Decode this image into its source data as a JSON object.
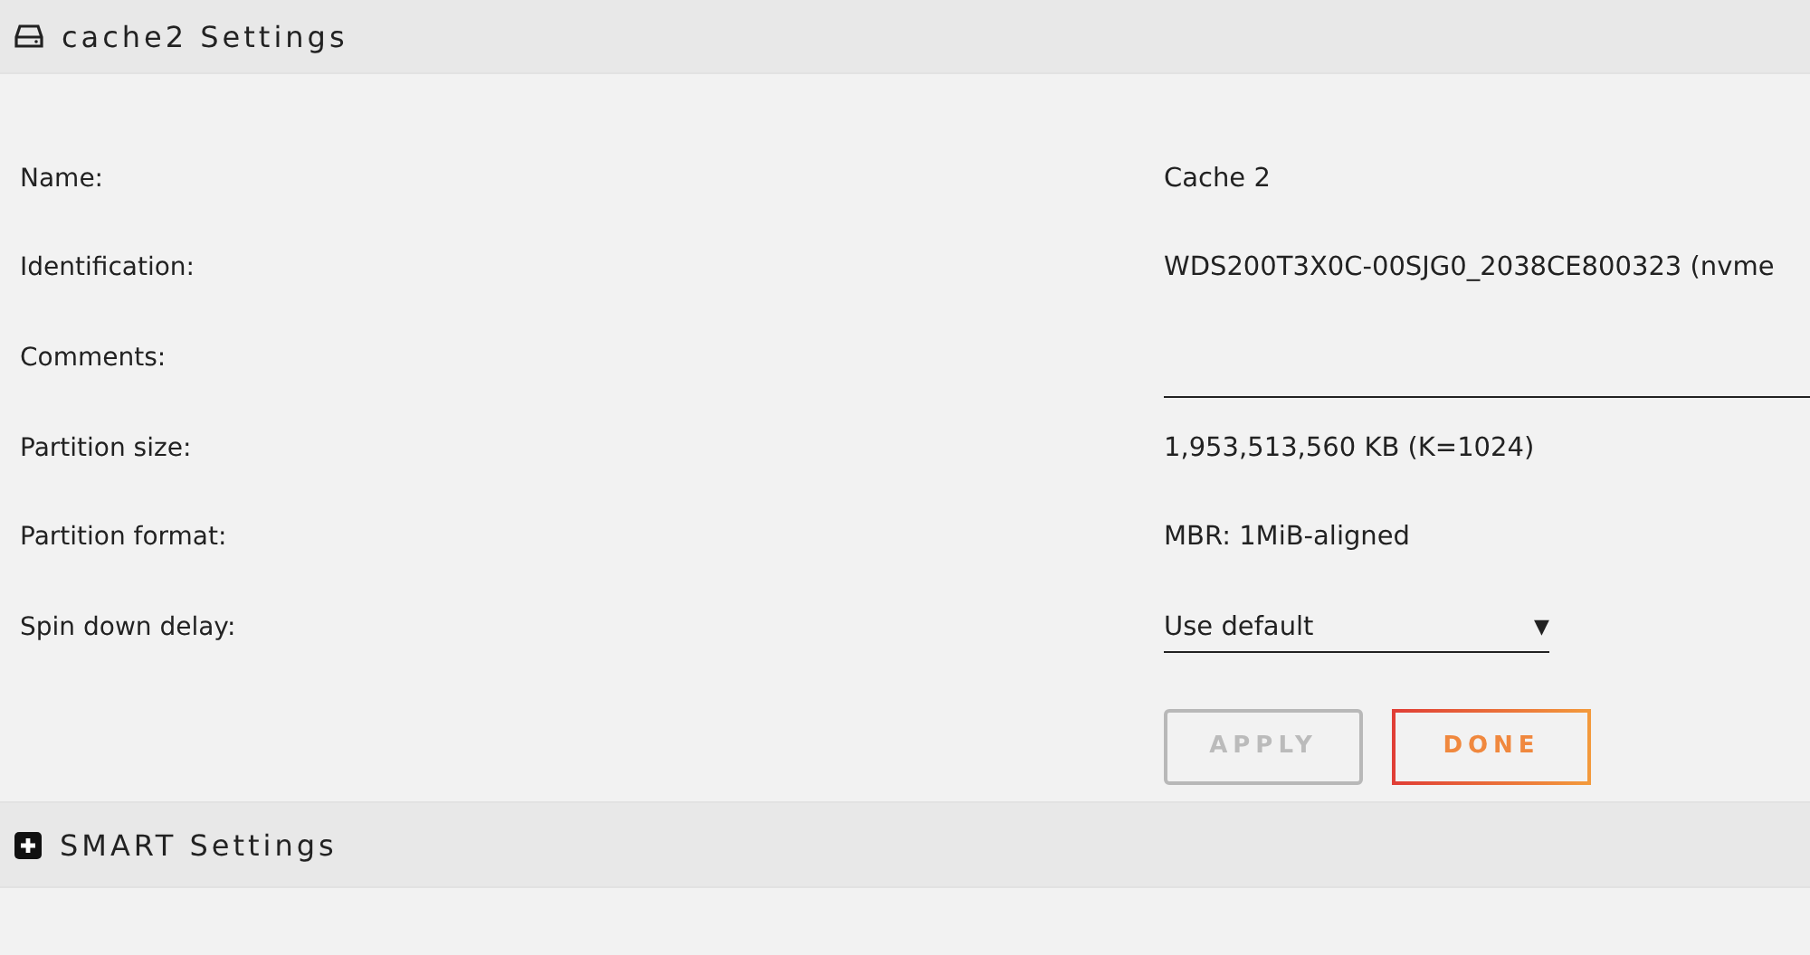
{
  "header": {
    "title": "cache2 Settings"
  },
  "rows": [
    {
      "label": "Name:",
      "kind": "text",
      "value": "Cache 2"
    },
    {
      "label": "Identification:",
      "kind": "text",
      "value": "WDS200T3X0C-00SJG0_2038CE800323 (nvme"
    },
    {
      "label": "Comments:",
      "kind": "field"
    },
    {
      "label": "Partition size:",
      "kind": "text",
      "value": "1,953,513,560 KB (K=1024)"
    },
    {
      "label": "Partition format:",
      "kind": "text",
      "value": "MBR: 1MiB-aligned"
    },
    {
      "label": "Spin down delay:",
      "kind": "select",
      "value": "Use default",
      "caret": "▼"
    }
  ],
  "buttons": [
    {
      "label": "APPLY",
      "disabled": true
    },
    {
      "label": "DONE",
      "disabled": false
    }
  ],
  "section": {
    "title": "SMART Settings",
    "expanded": false
  }
}
